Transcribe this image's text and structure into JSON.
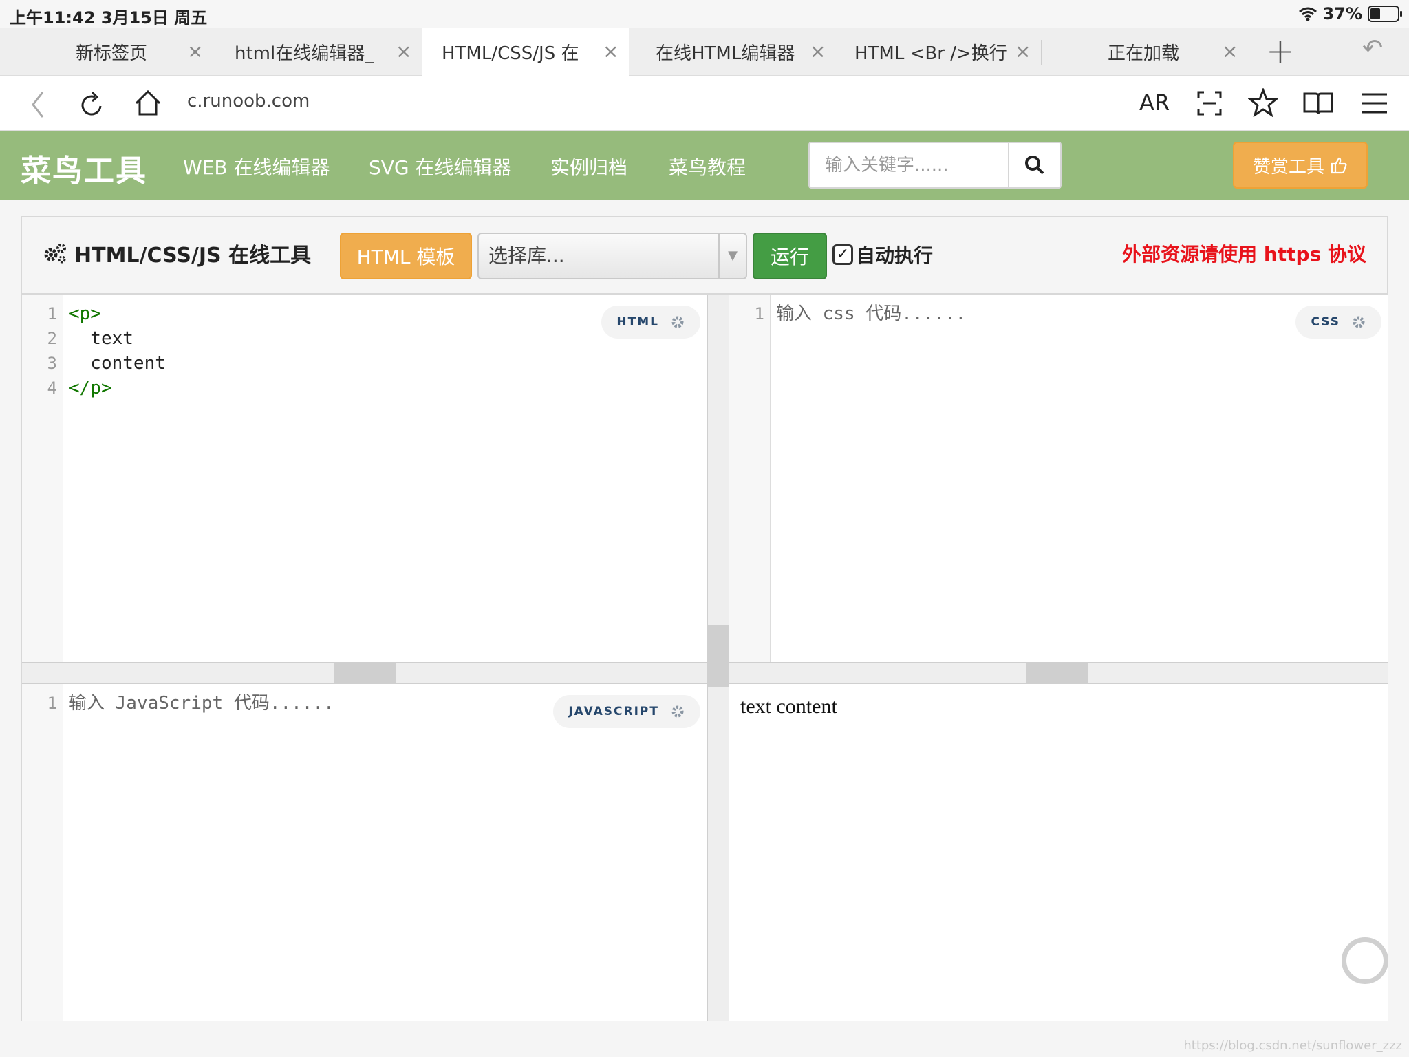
{
  "status_bar": {
    "time_date": "上午11:42  3月15日 周五",
    "battery": "37%"
  },
  "tabs": [
    {
      "title": "新标签页",
      "close": "×"
    },
    {
      "title": "html在线编辑器_",
      "close": "×"
    },
    {
      "title": "HTML/CSS/JS 在",
      "close": "×"
    },
    {
      "title": "在线HTML编辑器",
      "close": "×"
    },
    {
      "title": "HTML <Br />换行",
      "close": "×"
    },
    {
      "title": "正在加载",
      "close": "×"
    }
  ],
  "tabbar": {
    "new_tab": "+",
    "undo": "↶"
  },
  "urlbar": {
    "url": "c.runoob.com",
    "ar_label": "AR"
  },
  "site": {
    "logo": "菜鸟工具",
    "nav": [
      "WEB 在线编辑器",
      "SVG 在线编辑器",
      "实例归档",
      "菜鸟教程"
    ],
    "search_placeholder": "输入关键字......",
    "sponsor": "赞赏工具"
  },
  "tool": {
    "title": "HTML/CSS/JS 在线工具",
    "template_button": "HTML 模板",
    "library_select": "选择库...",
    "run_button": "运行",
    "autorun_label": "自动执行",
    "autorun_checked": true,
    "https_note": "外部资源请使用 https 协议"
  },
  "editors": {
    "html": {
      "badge": "HTML",
      "line_numbers": [
        "1",
        "2",
        "3",
        "4"
      ],
      "lines": [
        "<p>",
        "  text",
        "  content",
        "</p>"
      ]
    },
    "css": {
      "badge": "CSS",
      "line_numbers": [
        "1"
      ],
      "placeholder": "输入 css 代码......"
    },
    "js": {
      "badge": "JAVASCRIPT",
      "line_numbers": [
        "1"
      ],
      "placeholder": "输入 JavaScript 代码......"
    }
  },
  "result": {
    "text": "text content"
  },
  "watermark": "https://blog.csdn.net/sunflower_zzz",
  "colors": {
    "site_green": "#96bb7c",
    "orange": "#f0ad4e",
    "run_green": "#449d44",
    "note_red": "#e8131b",
    "tag_green": "#117700"
  }
}
